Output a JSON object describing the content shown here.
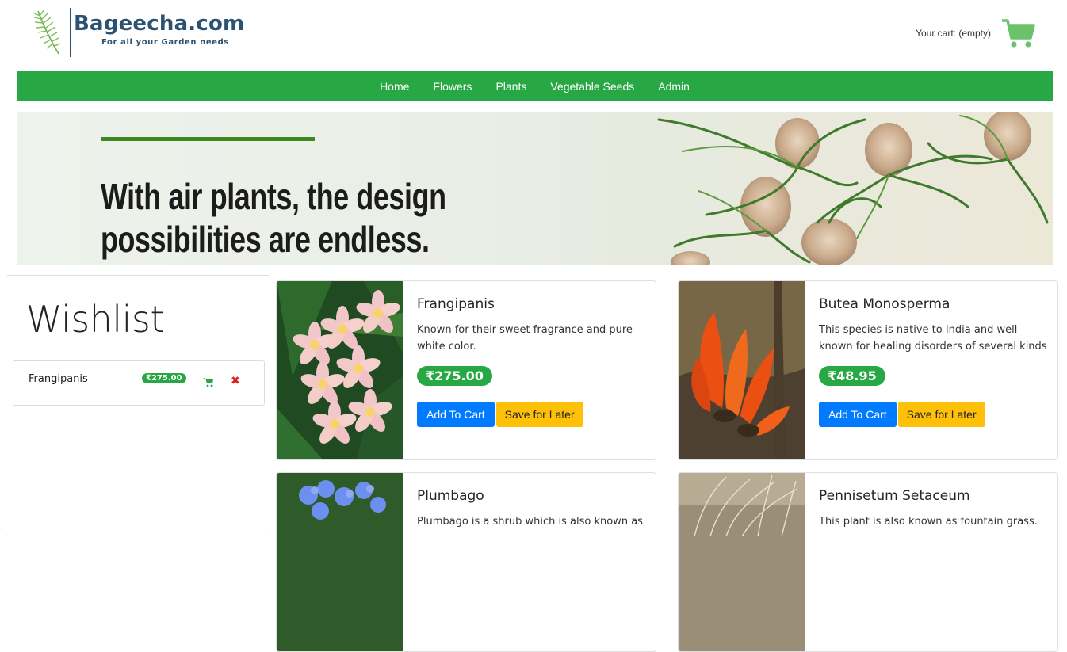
{
  "brand": {
    "name": "Bageecha.com",
    "tagline": "For all your Garden needs",
    "primary_color": "#28a745",
    "logo_color": "#2c5272"
  },
  "cart": {
    "label": "Your cart: (empty)",
    "icon": "cart-icon"
  },
  "nav": {
    "items": [
      {
        "label": "Home"
      },
      {
        "label": "Flowers"
      },
      {
        "label": "Plants"
      },
      {
        "label": "Vegetable Seeds"
      },
      {
        "label": "Admin"
      }
    ]
  },
  "banner": {
    "line1": "With air plants, the design",
    "line2": "possibilities are endless."
  },
  "wishlist": {
    "title": "Wishlist",
    "items": [
      {
        "name": "Frangipanis",
        "price": "₹275.00",
        "cart_icon": "cart-icon",
        "remove_icon": "close-icon",
        "remove_glyph": "✖"
      }
    ]
  },
  "products": [
    {
      "name": "Frangipanis",
      "description": "Known for their sweet fragrance and pure white color.",
      "price": "₹275.00",
      "add_label": "Add To Cart",
      "later_label": "Save for Later"
    },
    {
      "name": "Butea Monosperma",
      "description": "This species is native to India and well known for healing disorders of several kinds",
      "price": "₹48.95",
      "add_label": "Add To Cart",
      "later_label": "Save for Later"
    },
    {
      "name": "Plumbago",
      "description": "Plumbago is a shrub which is also known as"
    },
    {
      "name": "Pennisetum Setaceum",
      "description": "This plant is also known as fountain grass."
    }
  ]
}
